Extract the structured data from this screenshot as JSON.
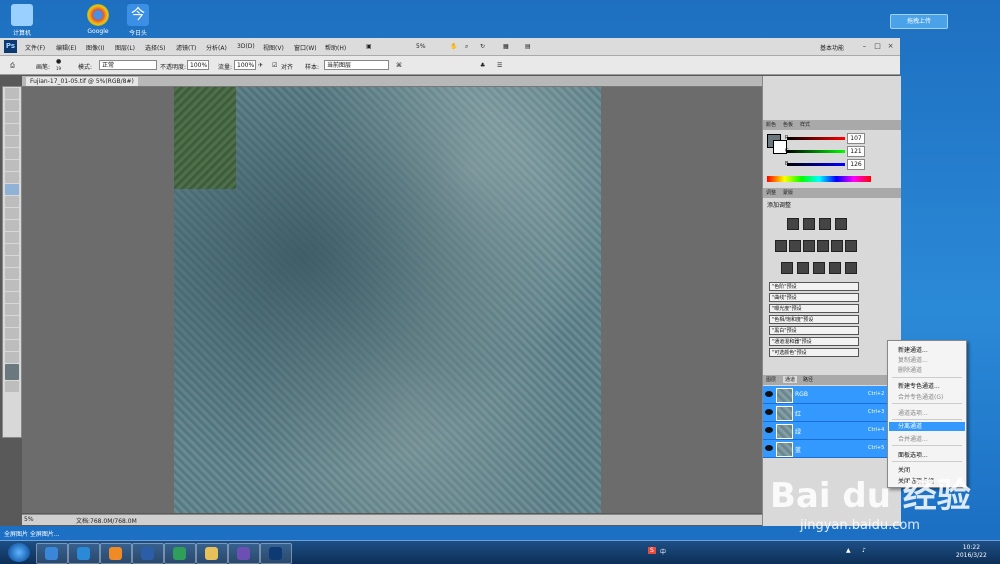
{
  "desktop": {
    "icons": [
      {
        "label": "计算机",
        "icon": "computer-icon",
        "color": "#9ad0ff"
      },
      {
        "label": "Google",
        "icon": "chrome-icon",
        "color": "#e04a3a"
      },
      {
        "label": "今日头",
        "icon": "toutiao-icon",
        "color": "#3b8fe4"
      }
    ],
    "upload_button": "拖拽上传"
  },
  "photoshop": {
    "logo": "Ps",
    "menus": [
      "文件(F)",
      "编辑(E)",
      "图像(I)",
      "图层(L)",
      "选择(S)",
      "滤镜(T)",
      "分析(A)",
      "3D(D)",
      "视图(V)",
      "窗口(W)",
      "帮助(H)"
    ],
    "zoom_menu": "5%",
    "workspace": "基本功能",
    "options": {
      "brush_label": "画笔:",
      "brush_size": "19",
      "mode_label": "模式:",
      "mode_value": "正常",
      "opacity_label": "不透明度:",
      "opacity_value": "100%",
      "flow_label": "流量:",
      "flow_value": "100%",
      "align_label": "对齐",
      "sample_label": "样本:",
      "sample_value": "当前图层"
    },
    "document_tab": "Fujian-17_01-05.tif @ 5%(RGB/8#)",
    "status": {
      "zoom": "5%",
      "doc": "文档:768.0M/768.0M"
    },
    "color_panel": {
      "tabs": [
        "颜色",
        "色板",
        "样式"
      ],
      "channels": [
        {
          "label": "R",
          "value": "107",
          "fraction": 0.42
        },
        {
          "label": "G",
          "value": "121",
          "fraction": 0.47
        },
        {
          "label": "B",
          "value": "126",
          "fraction": 0.49
        }
      ]
    },
    "adjust_panel": {
      "tabs": [
        "调整",
        "蒙版"
      ],
      "title": "添加调整",
      "presets": [
        "\"色阶\"预设",
        "\"曲线\"预设",
        "\"曝光度\"预设",
        "\"色相/饱和度\"预设",
        "\"黑白\"预设",
        "\"通道混和器\"预设",
        "\"可选颜色\"预设"
      ]
    },
    "channels_panel": {
      "tabs": [
        "图层",
        "通道",
        "路径"
      ],
      "rows": [
        {
          "name": "RGB",
          "shortcut": "Ctrl+2"
        },
        {
          "name": "红",
          "shortcut": "Ctrl+3"
        },
        {
          "name": "绿",
          "shortcut": "Ctrl+4"
        },
        {
          "name": "蓝",
          "shortcut": "Ctrl+5"
        }
      ]
    },
    "context_menu": {
      "items": [
        {
          "label": "新建通道...",
          "state": "normal"
        },
        {
          "label": "复制通道...",
          "state": "disabled"
        },
        {
          "label": "删除通道",
          "state": "disabled"
        },
        {
          "label": "新建专色通道...",
          "state": "normal"
        },
        {
          "label": "合并专色通道(G)",
          "state": "disabled"
        },
        {
          "label": "通道选项...",
          "state": "disabled"
        },
        {
          "label": "分离通道",
          "state": "selected"
        },
        {
          "label": "合并通道...",
          "state": "disabled"
        },
        {
          "label": "面板选项...",
          "state": "normal"
        },
        {
          "label": "关闭",
          "state": "normal"
        },
        {
          "label": "关闭选项卡组",
          "state": "normal"
        }
      ]
    }
  },
  "taskbar": {
    "path_text": "全屏图片  全屏图片...",
    "ime": "中",
    "time": "10:22",
    "date": "2016/3/22",
    "apps": [
      {
        "icon": "baidu-browser-icon",
        "color": "#3a86d8"
      },
      {
        "icon": "ie-icon",
        "color": "#2b8ad8"
      },
      {
        "icon": "firefox-icon",
        "color": "#f08a24"
      },
      {
        "icon": "word-icon",
        "color": "#2b5ea7"
      },
      {
        "icon": "search-app-icon",
        "color": "#2f9e5a"
      },
      {
        "icon": "folder-icon",
        "color": "#e6c15a"
      },
      {
        "icon": "media-icon",
        "color": "#6b4fb3"
      },
      {
        "icon": "photoshop-icon",
        "color": "#0d3a72"
      }
    ]
  },
  "watermark": {
    "brand": "Bai du 经验",
    "url": "jingyan.baidu.com"
  }
}
